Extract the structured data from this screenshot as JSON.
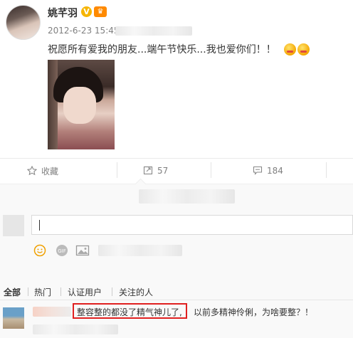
{
  "post": {
    "author": "姚芊羽",
    "verified_badge": "V",
    "level_badge": "♛",
    "timestamp": "2012-6-23 15:45",
    "text": "祝愿所有爱我的朋友...端午节快乐...我也爱你们！！"
  },
  "actions": {
    "favorite_label": "收藏",
    "repost_count": "57",
    "comment_count": "184"
  },
  "comment_tabs": [
    "全部",
    "热门",
    "认证用户",
    "关注的人"
  ],
  "comment": {
    "highlighted_text": "整容整的都没了精气神儿了,",
    "rest_text": "以前多精神伶俐，为啥要整？！"
  },
  "colors": {
    "link": "#eb7350",
    "highlight_box": "#e02020",
    "muted": "#808080"
  },
  "icons": [
    "star-icon",
    "repost-icon",
    "comment-icon",
    "emoji-icon",
    "gif-icon",
    "image-icon"
  ]
}
